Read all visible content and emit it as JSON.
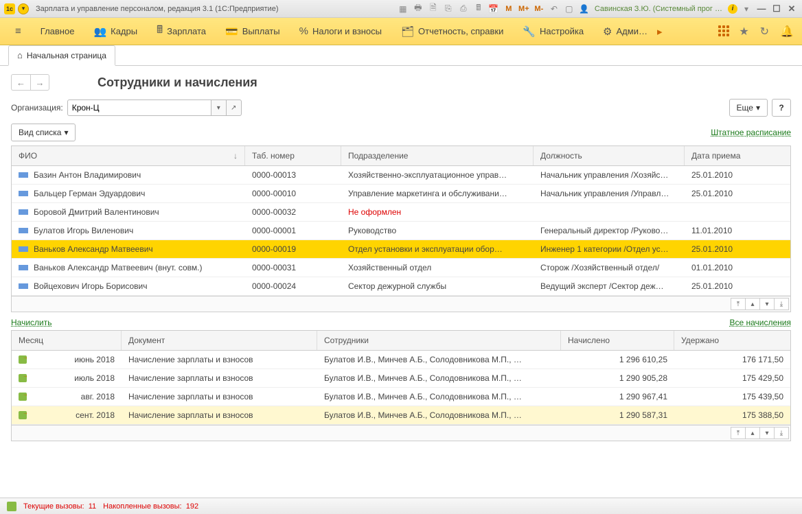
{
  "titlebar": {
    "app_title": "Зарплата и управление персоналом, редакция 3.1  (1С:Предприятие)",
    "m": "M",
    "m_plus": "M+",
    "m_minus": "M-",
    "user_name": "Савинская З.Ю. (Системный прог …"
  },
  "menu": {
    "main": "Главное",
    "staff": "Кадры",
    "salary": "Зарплата",
    "payments": "Выплаты",
    "taxes": "Налоги и взносы",
    "reports": "Отчетность, справки",
    "settings": "Настройка",
    "admin": "Адми…"
  },
  "tab": {
    "home": "Начальная страница"
  },
  "page": {
    "title": "Сотрудники и начисления"
  },
  "filter": {
    "label": "Организация:",
    "value": "Крон-Ц",
    "more": "Еще",
    "help": "?"
  },
  "view_button": "Вид списка",
  "link_schedule": "Штатное расписание",
  "columns_top": {
    "fio": "ФИО",
    "tab_no": "Таб. номер",
    "dept": "Подразделение",
    "position": "Должность",
    "hire_date": "Дата приема"
  },
  "rows_top": [
    {
      "fio": "Базин Антон Владимирович",
      "tab": "0000-00013",
      "dept": "Хозяйственно-эксплуатационное управ…",
      "pos": "Начальник управления /Хозяйс…",
      "date": "25.01.2010",
      "sel": false
    },
    {
      "fio": "Бальцер Герман Эдуардович",
      "tab": "0000-00010",
      "dept": "Управление маркетинга и обслуживани…",
      "pos": "Начальник управления /Управл…",
      "date": "25.01.2010",
      "sel": false
    },
    {
      "fio": "Боровой Дмитрий Валентинович",
      "tab": "0000-00032",
      "dept": "Не оформлен",
      "pos": "",
      "date": "",
      "sel": false,
      "red": true
    },
    {
      "fio": "Булатов Игорь Виленович",
      "tab": "0000-00001",
      "dept": "Руководство",
      "pos": "Генеральный директор /Руково…",
      "date": "11.01.2010",
      "sel": false
    },
    {
      "fio": "Ваньков Александр Матвеевич",
      "tab": "0000-00019",
      "dept": "Отдел установки и эксплуатации обор…",
      "pos": "Инженер 1 категории /Отдел ус…",
      "date": "25.01.2010",
      "sel": true
    },
    {
      "fio": "Ваньков Александр Матвеевич (внут. совм.)",
      "tab": "0000-00031",
      "dept": "Хозяйственный отдел",
      "pos": "Сторож /Хозяйственный отдел/",
      "date": "01.01.2010",
      "sel": false
    },
    {
      "fio": "Войцехович Игорь Борисович",
      "tab": "0000-00024",
      "dept": "Сектор дежурной службы",
      "pos": "Ведущий эксперт /Сектор деж…",
      "date": "25.01.2010",
      "sel": false
    }
  ],
  "link_accrue": "Начислить",
  "link_all": "Все начисления",
  "columns_bot": {
    "month": "Месяц",
    "doc": "Документ",
    "emp": "Сотрудники",
    "accrued": "Начислено",
    "withheld": "Удержано"
  },
  "rows_bot": [
    {
      "month": "июнь 2018",
      "doc": "Начисление зарплаты и взносов",
      "emp": "Булатов И.В., Минчев А.Б., Солодовникова М.П., …",
      "acc": "1 296 610,25",
      "wth": "176 171,50",
      "soft": false
    },
    {
      "month": "июль 2018",
      "doc": "Начисление зарплаты и взносов",
      "emp": "Булатов И.В., Минчев А.Б., Солодовникова М.П., …",
      "acc": "1 290 905,28",
      "wth": "175 429,50",
      "soft": false
    },
    {
      "month": "авг. 2018",
      "doc": "Начисление зарплаты и взносов",
      "emp": "Булатов И.В., Минчев А.Б., Солодовникова М.П., …",
      "acc": "1 290 967,41",
      "wth": "175 439,50",
      "soft": false
    },
    {
      "month": "сент. 2018",
      "doc": "Начисление зарплаты и взносов",
      "emp": "Булатов И.В., Минчев А.Б., Солодовникова М.П., …",
      "acc": "1 290 587,31",
      "wth": "175 388,50",
      "soft": true
    }
  ],
  "status": {
    "current_label": "Текущие вызовы:",
    "current_val": "11",
    "total_label": "Накопленные вызовы:",
    "total_val": "192"
  }
}
